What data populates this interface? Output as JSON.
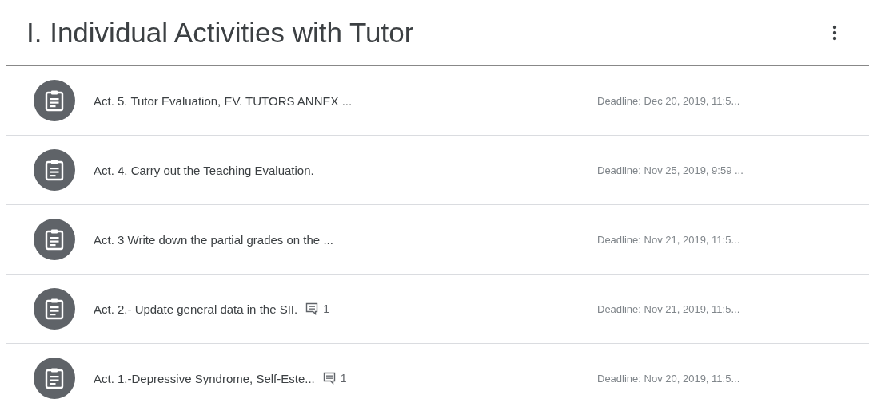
{
  "topic": {
    "title": "I. Individual Activities with Tutor"
  },
  "assignments": [
    {
      "title": "Act. 5. Tutor Evaluation, EV. TUTORS ANNEX ...",
      "deadline": "Deadline: Dec 20, 2019, 11:5..."
    },
    {
      "title": "Act. 4. Carry out the Teaching Evaluation.",
      "deadline": "Deadline: Nov 25, 2019, 9:59 ..."
    },
    {
      "title": "Act. 3 Write down the partial grades on the ...",
      "deadline": "Deadline: Nov 21, 2019, 11:5..."
    },
    {
      "title": "Act. 2.- Update general data in the SII.",
      "comments": "1",
      "deadline": "Deadline: Nov 21, 2019, 11:5..."
    },
    {
      "title": "Act. 1.-Depressive Syndrome, Self-Este...",
      "comments": "1",
      "deadline": "Deadline: Nov 20, 2019, 11:5..."
    }
  ]
}
